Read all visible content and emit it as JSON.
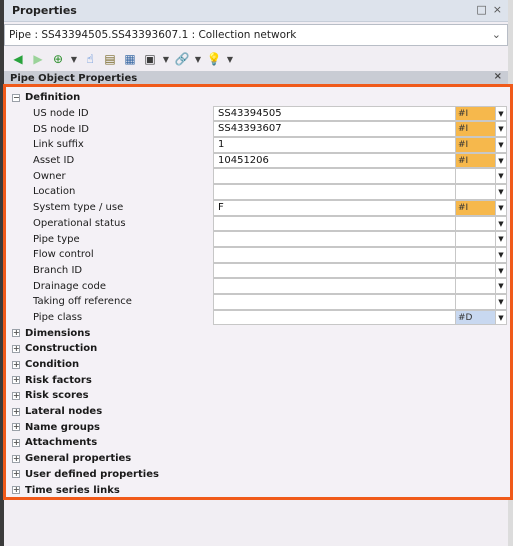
{
  "panel": {
    "title": "Properties",
    "controls": [
      "□",
      "×"
    ]
  },
  "object_selector": {
    "value": "Pipe : SS43394505.SS43393607.1 : Collection network"
  },
  "toolbar": {
    "icons": [
      "back-icon",
      "forward-icon",
      "refresh-icon",
      "pointer-icon",
      "notes-icon",
      "grid-icon",
      "save-icon",
      "link-icon",
      "help-icon"
    ]
  },
  "section_header": {
    "title": "Pipe Object Properties",
    "close": "×"
  },
  "tree": {
    "definition": {
      "label": "Definition",
      "rows": [
        {
          "label": "US node ID",
          "value": "SS43394505",
          "flag": "#I",
          "flag_style": "orange"
        },
        {
          "label": "DS node ID",
          "value": "SS43393607",
          "flag": "#I",
          "flag_style": "orange"
        },
        {
          "label": "Link suffix",
          "value": "1",
          "flag": "#I",
          "flag_style": "orange"
        },
        {
          "label": "Asset ID",
          "value": "10451206",
          "flag": "#I",
          "flag_style": "orange"
        },
        {
          "label": "Owner",
          "value": "",
          "flag": "",
          "flag_style": ""
        },
        {
          "label": "Location",
          "value": "",
          "flag": "",
          "flag_style": ""
        },
        {
          "label": "System type / use",
          "value": "F",
          "flag": "#I",
          "flag_style": "orange"
        },
        {
          "label": "Operational status",
          "value": "",
          "flag": "",
          "flag_style": ""
        },
        {
          "label": "Pipe type",
          "value": "",
          "flag": "",
          "flag_style": ""
        },
        {
          "label": "Flow control",
          "value": "",
          "flag": "",
          "flag_style": ""
        },
        {
          "label": "Branch ID",
          "value": "",
          "flag": "",
          "flag_style": ""
        },
        {
          "label": "Drainage code",
          "value": "",
          "flag": "",
          "flag_style": ""
        },
        {
          "label": "Taking off reference",
          "value": "",
          "flag": "",
          "flag_style": ""
        },
        {
          "label": "Pipe class",
          "value": "",
          "flag": "#D",
          "flag_style": "blue"
        }
      ]
    },
    "groups": [
      "Dimensions",
      "Construction",
      "Condition",
      "Risk factors",
      "Risk scores",
      "Lateral nodes",
      "Name groups",
      "Attachments",
      "General properties",
      "User defined properties",
      "Time series links"
    ]
  },
  "colors": {
    "highlight_frame": "#f05a1a",
    "flag_orange": "#f6b84c",
    "flag_blue": "#c8d8f0"
  }
}
